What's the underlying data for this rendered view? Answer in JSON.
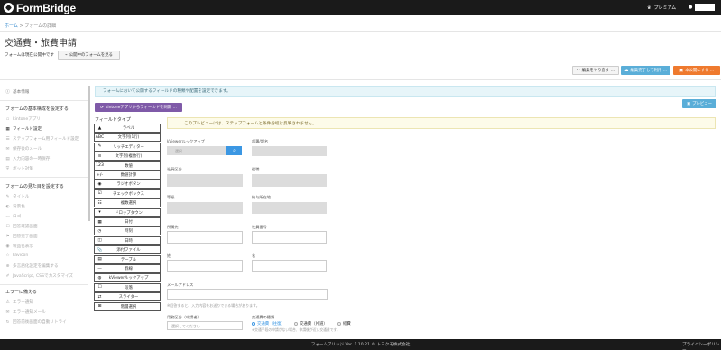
{
  "header": {
    "logo_text": "FormBridge",
    "premium_label": "プレミアム",
    "user_icon": "user-icon",
    "premium_icon": "crown-icon"
  },
  "breadcrumb": {
    "home": "ホーム",
    "separator": ">",
    "current": "フォームの詳細"
  },
  "page": {
    "title": "交通費・旅費申請",
    "status_text": "フォームは現在公開中です",
    "public_form_button": "公開中のフォームを見る"
  },
  "actions": {
    "undo": "編集をやり直す ...",
    "save_draft": "編集完了して利用 ...",
    "publish": "本公開にする ..."
  },
  "sidebar": {
    "top_item": "基本情報",
    "section1": "フォームの基本構成を設定する",
    "section1_items": [
      "kintoneアプリ",
      "フィールド設定",
      "ステップフォーム用フィールド設定",
      "保存後のメール",
      "入力内容の一時保存",
      "ボット対策"
    ],
    "section2": "フォームの見た目を設定する",
    "section2_items": [
      "タイトル",
      "背景色",
      "ロゴ",
      "回答確認画面",
      "回答完了画面",
      "製品名表示",
      "Favicon",
      "多言語化設定を編集する",
      "JavaScript, CSSでカスタマイズ"
    ],
    "section3": "エラーに備える",
    "section3_items": [
      "エラー通知",
      "エラー通知メール",
      "回答前後画面の自動リトライ"
    ]
  },
  "main": {
    "info_text": "フォームにおいて公開するフィールドの種類や配置を設定できます。",
    "kintone_button": "kintoneアプリからフィールドを同期 ...",
    "preview_button": "プレビュー",
    "field_types_title": "フィールドタイプ",
    "preview_note": "このプレビューには、ステップフォームと条件分岐は反映されません。"
  },
  "field_types": [
    {
      "icon": "▲",
      "label": "ラベル"
    },
    {
      "icon": "ABC",
      "label": "文字列(1行)"
    },
    {
      "icon": "✎",
      "label": "リッチエディター"
    },
    {
      "icon": "≡",
      "label": "文字列(複数行)"
    },
    {
      "icon": "123",
      "label": "数値"
    },
    {
      "icon": "+/-",
      "label": "数値計算"
    },
    {
      "icon": "◉",
      "label": "ラジオボタン"
    },
    {
      "icon": "☑",
      "label": "チェックボックス"
    },
    {
      "icon": "☷",
      "label": "複数選択"
    },
    {
      "icon": "▾",
      "label": "ドロップダウン"
    },
    {
      "icon": "▦",
      "label": "日付"
    },
    {
      "icon": "◷",
      "label": "時刻"
    },
    {
      "icon": "◫",
      "label": "日時"
    },
    {
      "icon": "📎",
      "label": "添付ファイル"
    },
    {
      "icon": "▤",
      "label": "テーブル"
    },
    {
      "icon": "—",
      "label": "罫線"
    },
    {
      "icon": "◍",
      "label": "kViewerルックアップ"
    },
    {
      "icon": "☐",
      "label": "段落"
    },
    {
      "icon": "⇄",
      "label": "スライダー"
    },
    {
      "icon": "⊞",
      "label": "階層選択"
    }
  ],
  "form": {
    "lookup_label": "kViewerルックアップ",
    "lookup_placeholder": "選択",
    "lookup_button_icon": "search-icon",
    "department_label": "部署/課名",
    "employee_label": "社員区分",
    "post_label": "役職",
    "grade_label": "等級",
    "salary_label": "給与所在地",
    "affiliation_label": "所属先",
    "employee_no_label": "社員番号",
    "last_name_label": "姓",
    "first_name_label": "名",
    "email_label": "メールアドレス",
    "email_hint": "※回答すると、入力内容をお送りできる場合があります。",
    "business_label": "用務区分（申請者）",
    "business_placeholder": "選択してください",
    "transport_label": "交通費の種類",
    "transport_options": [
      "交通費（往復）",
      "交通費（片道）",
      "経費"
    ],
    "transport_hint": "※交通手段の申請がない場合、申請後が近い交通費です。"
  },
  "footer": {
    "text": "フォームブリッジ  Ver. 1.10.21  © トヨクモ株式会社",
    "privacy": "プライバシーポリシー"
  }
}
